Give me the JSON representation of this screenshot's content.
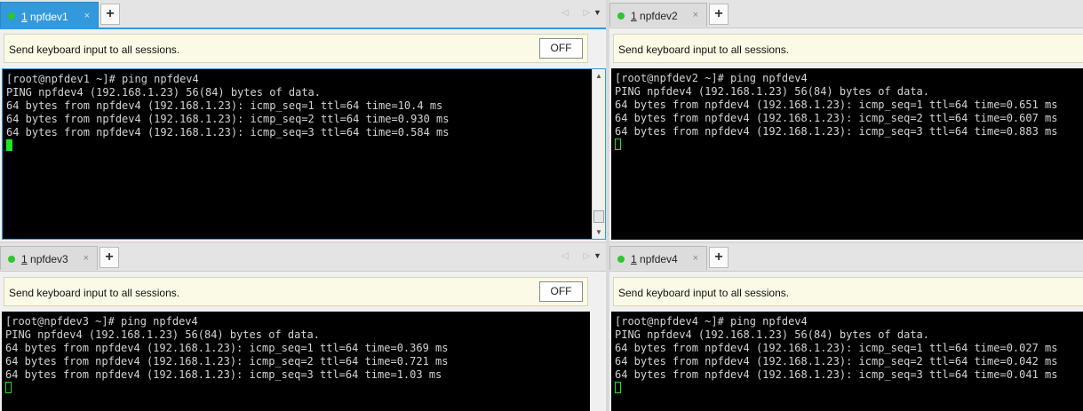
{
  "broadcast_text": "Send keyboard input to all sessions.",
  "off_label": "OFF",
  "add_tab_symbol": "+",
  "tab_close_symbol": "×",
  "tab_number": "1",
  "nav_arrows": "◁ ▷",
  "dropdown_symbol": "▼",
  "colors": {
    "active_tab": "#3399dd",
    "connected_dot": "#2ec52e",
    "cursor": "#1ee61e",
    "terminal_bg": "#000000"
  },
  "panes": [
    {
      "tab_name": "npfdev1",
      "lines": [
        "[root@npfdev1 ~]# ping npfdev4",
        "PING npfdev4 (192.168.1.23) 56(84) bytes of data.",
        "64 bytes from npfdev4 (192.168.1.23): icmp_seq=1 ttl=64 time=10.4 ms",
        "64 bytes from npfdev4 (192.168.1.23): icmp_seq=2 ttl=64 time=0.930 ms",
        "64 bytes from npfdev4 (192.168.1.23): icmp_seq=3 ttl=64 time=0.584 ms"
      ]
    },
    {
      "tab_name": "npfdev2",
      "lines": [
        "[root@npfdev2 ~]# ping npfdev4",
        "PING npfdev4 (192.168.1.23) 56(84) bytes of data.",
        "64 bytes from npfdev4 (192.168.1.23): icmp_seq=1 ttl=64 time=0.651 ms",
        "64 bytes from npfdev4 (192.168.1.23): icmp_seq=2 ttl=64 time=0.607 ms",
        "64 bytes from npfdev4 (192.168.1.23): icmp_seq=3 ttl=64 time=0.883 ms"
      ]
    },
    {
      "tab_name": "npfdev3",
      "lines": [
        "[root@npfdev3 ~]# ping npfdev4",
        "PING npfdev4 (192.168.1.23) 56(84) bytes of data.",
        "64 bytes from npfdev4 (192.168.1.23): icmp_seq=1 ttl=64 time=0.369 ms",
        "64 bytes from npfdev4 (192.168.1.23): icmp_seq=2 ttl=64 time=0.721 ms",
        "64 bytes from npfdev4 (192.168.1.23): icmp_seq=3 ttl=64 time=1.03 ms"
      ]
    },
    {
      "tab_name": "npfdev4",
      "lines": [
        "[root@npfdev4 ~]# ping npfdev4",
        "PING npfdev4 (192.168.1.23) 56(84) bytes of data.",
        "64 bytes from npfdev4 (192.168.1.23): icmp_seq=1 ttl=64 time=0.027 ms",
        "64 bytes from npfdev4 (192.168.1.23): icmp_seq=2 ttl=64 time=0.042 ms",
        "64 bytes from npfdev4 (192.168.1.23): icmp_seq=3 ttl=64 time=0.041 ms"
      ]
    }
  ]
}
